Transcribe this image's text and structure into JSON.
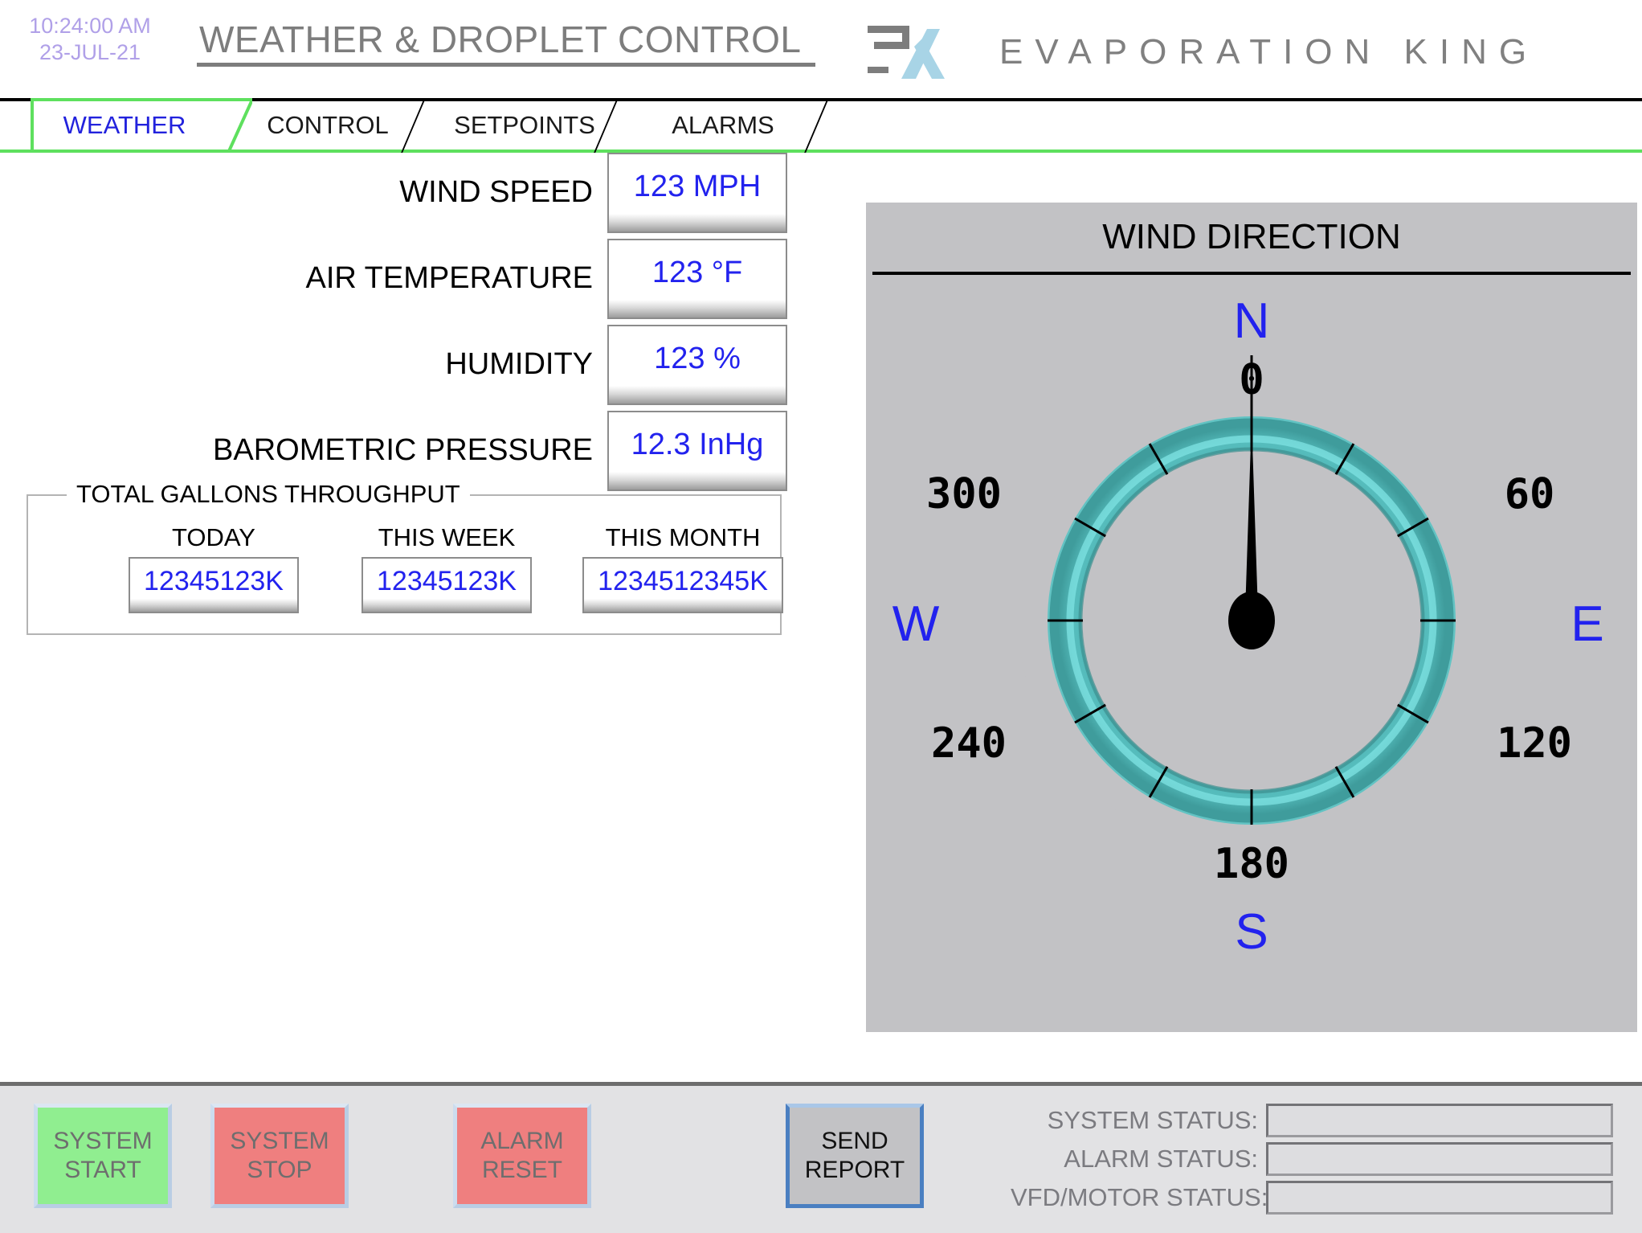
{
  "header": {
    "clock_time": "10:24:00 AM",
    "clock_date": "23-JUL-21",
    "title": "WEATHER & DROPLET CONTROL",
    "brand_name": "EVAPORATION KING",
    "logo_icon": "ek-monogram-logo",
    "clock_color": "#b0a0e8",
    "title_color": "#7d7d7d",
    "brand_color": "#808080",
    "logo_gray": "#7d7d7d",
    "logo_blue": "#a8d4e6"
  },
  "tabs": {
    "active": "WEATHER",
    "active_color": "#2222dd",
    "active_border_color": "#5ee05e",
    "items": [
      {
        "label": "WEATHER"
      },
      {
        "label": "CONTROL"
      },
      {
        "label": "SETPOINTS"
      },
      {
        "label": "ALARMS"
      }
    ]
  },
  "metrics": [
    {
      "label": "WIND SPEED",
      "value": "123 MPH"
    },
    {
      "label": "AIR TEMPERATURE",
      "value": "123 °F"
    },
    {
      "label": "HUMIDITY",
      "value": "123 %"
    },
    {
      "label": "BAROMETRIC PRESSURE",
      "value": "12.3 InHg"
    }
  ],
  "gallons": {
    "legend": "TOTAL GALLONS THROUGHPUT",
    "columns": [
      {
        "label": "TODAY",
        "value": "12345123K"
      },
      {
        "label": "THIS WEEK",
        "value": "12345123K"
      },
      {
        "label": "THIS MONTH",
        "value": "1234512345K"
      }
    ]
  },
  "gauge": {
    "title": "WIND DIRECTION",
    "panel_bg": "#c2c2c5",
    "ring_color": "#4fb3b3",
    "ring_highlight": "#7fe3e3",
    "needle_color": "#000000",
    "cardinal_color": "#2222ee",
    "value_deg": 0,
    "cardinals": [
      {
        "label": "N",
        "at_deg": 0
      },
      {
        "label": "E",
        "at_deg": 90
      },
      {
        "label": "S",
        "at_deg": 180
      },
      {
        "label": "W",
        "at_deg": 270
      }
    ],
    "degree_labels": [
      {
        "label": "0",
        "at_deg": 0
      },
      {
        "label": "60",
        "at_deg": 60
      },
      {
        "label": "120",
        "at_deg": 120
      },
      {
        "label": "180",
        "at_deg": 180
      },
      {
        "label": "240",
        "at_deg": 240
      },
      {
        "label": "300",
        "at_deg": 300
      }
    ],
    "tick_interval_deg": 30
  },
  "footer": {
    "buttons": [
      {
        "name": "system-start",
        "line1": "SYSTEM",
        "line2": "START",
        "fill": "#90ee90"
      },
      {
        "name": "system-stop",
        "line1": "SYSTEM",
        "line2": "STOP",
        "fill": "#ef7f7f"
      },
      {
        "name": "alarm-reset",
        "line1": "ALARM",
        "line2": "RESET",
        "fill": "#ef7f7f"
      },
      {
        "name": "send-report",
        "line1": "SEND",
        "line2": "REPORT",
        "fill": "#c2c2c5"
      }
    ],
    "status": [
      {
        "label": "SYSTEM STATUS:",
        "value": ""
      },
      {
        "label": "ALARM STATUS:",
        "value": ""
      },
      {
        "label": "VFD/MOTOR STATUS:",
        "value": ""
      }
    ]
  }
}
